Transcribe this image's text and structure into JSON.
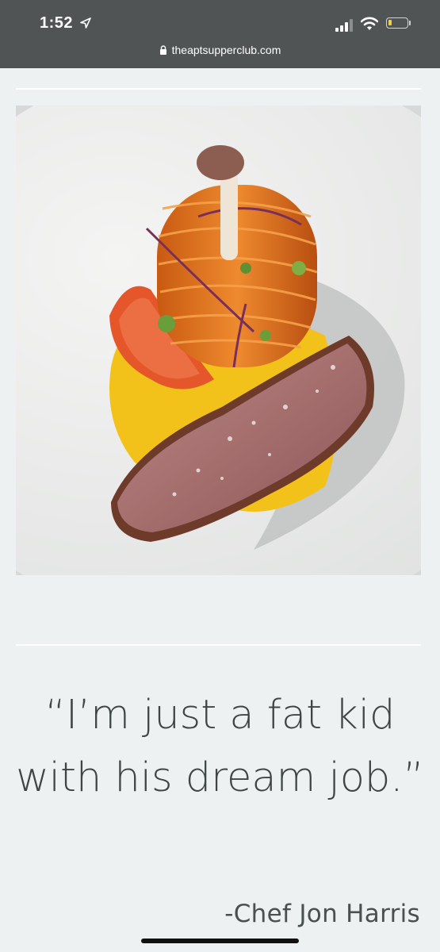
{
  "status_bar": {
    "time": "1:52",
    "icons": [
      "location-arrow-icon",
      "cellular-signal-icon",
      "wifi-icon",
      "battery-icon"
    ],
    "battery_color": "#f4cf39"
  },
  "browser": {
    "url": "theaptsupperclub.com",
    "lock_icon": "lock-icon"
  },
  "content": {
    "image_subject": "plated dish photo",
    "quote": "“I’m just a fat kid with his dream job.”",
    "attribution": "-Chef Jon Harris"
  },
  "colors": {
    "page_background": "#eef1f1",
    "chrome_background": "#505454",
    "text": "#3f4545"
  }
}
